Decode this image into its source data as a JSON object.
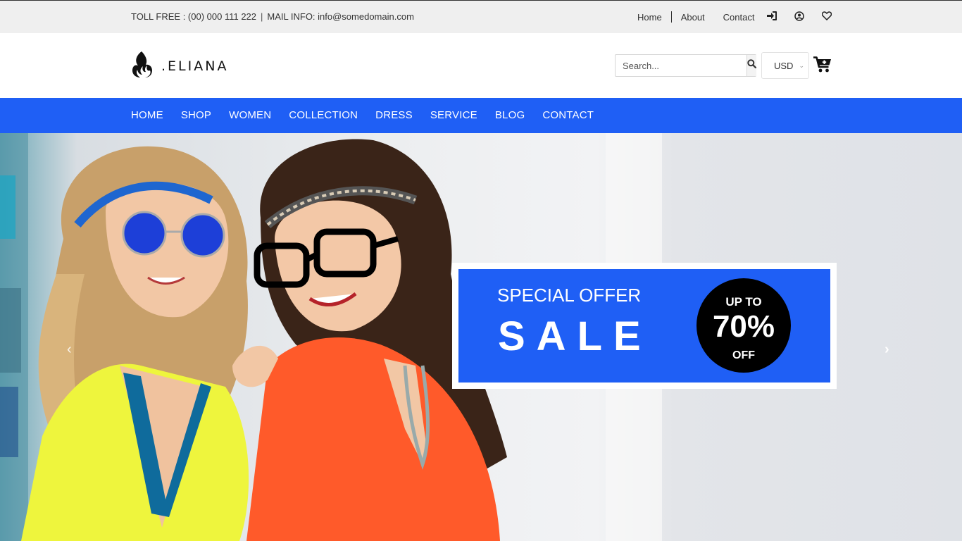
{
  "topbar": {
    "toll_free": "TOLL FREE : (00) 000 111 222",
    "separator": "|",
    "mail_info": "MAIL INFO: info@somedomain.com",
    "links": [
      "Home",
      "About",
      "Contact"
    ],
    "icons": [
      "sign-in-icon",
      "user-circle-icon",
      "heart-icon"
    ]
  },
  "header": {
    "logo_text": ".ELIANA",
    "search_placeholder": "Search...",
    "currency": "USD"
  },
  "nav": {
    "items": [
      "HOME",
      "SHOP",
      "WOMEN",
      "COLLECTION",
      "DRESS",
      "SERVICE",
      "BLOG",
      "CONTACT"
    ]
  },
  "hero": {
    "offer_title": "SPECIAL OFFER",
    "offer_sale": "SALE",
    "badge_top": "UP TO",
    "badge_pct": "70%",
    "badge_bottom": "OFF",
    "prev_arrow": "‹",
    "next_arrow": "›"
  },
  "colors": {
    "brand_blue": "#1f5ff5",
    "topbar_bg": "#efefef",
    "badge_bg": "#000000"
  }
}
